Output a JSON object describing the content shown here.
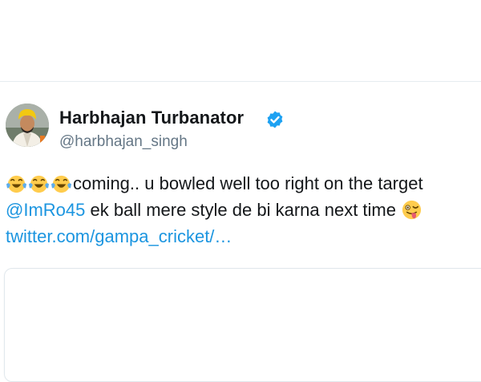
{
  "tweet": {
    "author": {
      "display_name": "Harbhajan Turbanator",
      "handle": "@harbhajan_singh",
      "verified": true,
      "verified_icon": "verified-badge-icon",
      "avatar_icon": "profile-photo"
    },
    "body": {
      "line1_emojis": [
        "face-with-tears-of-joy-icon",
        "face-with-tears-of-joy-icon",
        "face-with-tears-of-joy-icon"
      ],
      "line1_text": "coming.. u bowled well too right on the target",
      "mention": "@ImRo45",
      "line2_text": " ek ball mere style de bi karna next time",
      "line2_emoji": "winking-face-with-tongue-icon",
      "link": "twitter.com/gampa_cricket/…"
    }
  },
  "colors": {
    "link": "#1b95e0",
    "verified": "#1da1f2",
    "text": "#14171a",
    "secondary_text": "#657786",
    "divider": "#e6ecf0"
  }
}
